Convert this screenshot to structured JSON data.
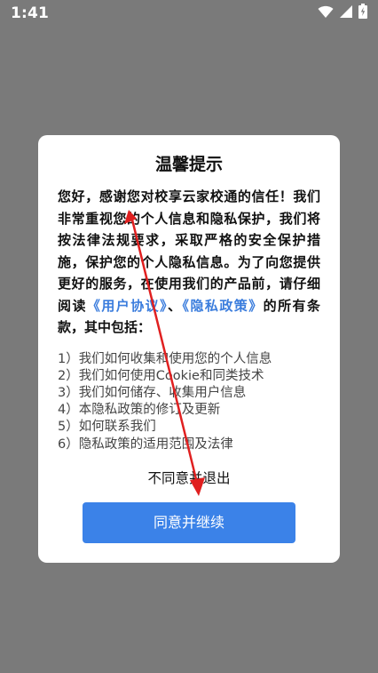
{
  "status_bar": {
    "time": "1:41",
    "icons": [
      "wifi-icon",
      "signal-icon",
      "battery-icon"
    ]
  },
  "dialog": {
    "title": "温馨提示",
    "intro_text": "您好，感谢您对校享云家校通的信任！我们非常重视您的个人信息和隐私保护，我们将按法律法规要求，采取严格的安全保护措施，保护您的个人隐私信息。为了向您提供更好的服务，在使用我们的产品前，请仔细阅读",
    "user_agreement_link": "《用户协议》",
    "separator": "、",
    "privacy_policy_link": "《隐私政策》",
    "outro_text": "的所有条款，其中包括：",
    "list": [
      "1）我们如何收集和使用您的个人信息",
      "2）我们如何使用Cookie和同类技术",
      "3）我们如何储存、收集用户信息",
      "4）本隐私政策的修订及更新",
      "5）如何联系我们",
      "6）隐私政策的适用范围及法律"
    ],
    "decline_label": "不同意并退出",
    "accept_label": "同意并继续"
  },
  "colors": {
    "overlay": "#7a7a7a",
    "link": "#3b7ddd",
    "accept_button": "#3b82e8",
    "annotation_arrow": "#e02020"
  }
}
